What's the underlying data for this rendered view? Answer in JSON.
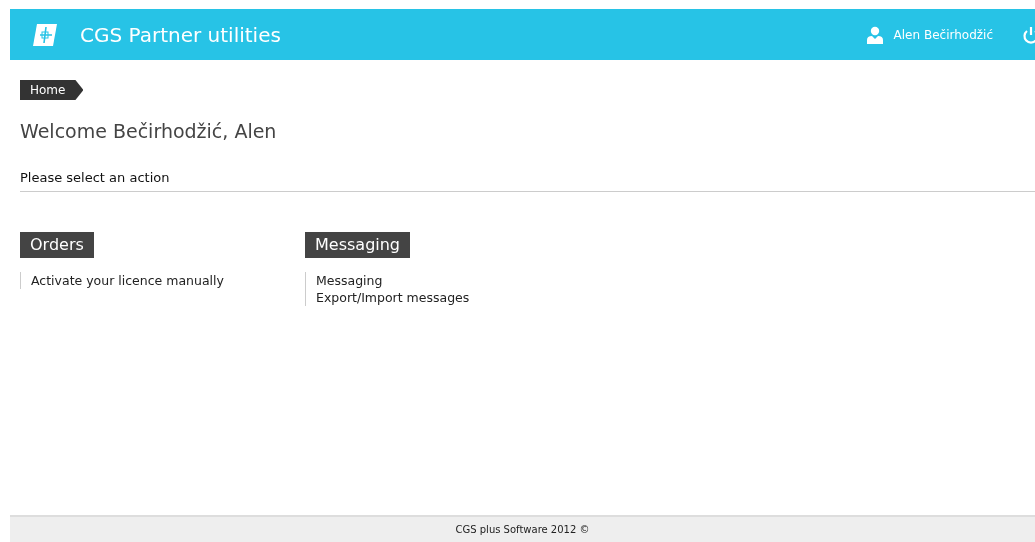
{
  "header": {
    "title": "CGS Partner utilities",
    "user_name": "Alen Bečirhodžić"
  },
  "breadcrumb": [
    "Home"
  ],
  "welcome": "Welcome Bečirhodžić, Alen",
  "instruction": "Please select an action",
  "sections": [
    {
      "title": "Orders",
      "links": [
        "Activate your licence manually"
      ]
    },
    {
      "title": "Messaging",
      "links": [
        "Messaging",
        "Export/Import messages"
      ]
    }
  ],
  "footer": "CGS plus Software 2012 ©"
}
